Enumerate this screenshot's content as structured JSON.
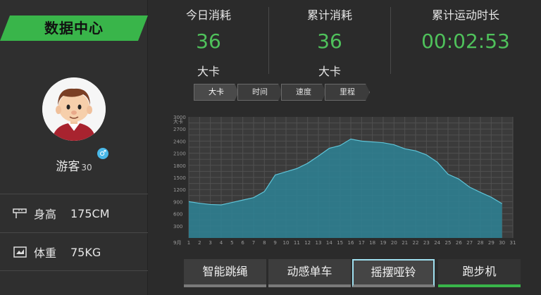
{
  "sidebar": {
    "banner_title": "数据中心",
    "user": {
      "name": "游客",
      "age": "30",
      "gender_symbol": "♂"
    },
    "height": {
      "label": "身高",
      "value": "175CM"
    },
    "weight": {
      "label": "体重",
      "value": "75KG"
    }
  },
  "metrics": [
    {
      "title": "今日消耗",
      "value": "36",
      "unit": "大卡"
    },
    {
      "title": "累计消耗",
      "value": "36",
      "unit": "大卡"
    },
    {
      "title": "累计运动时长",
      "value": "00:02:53"
    }
  ],
  "tabs": [
    {
      "label": "大卡"
    },
    {
      "label": "时间"
    },
    {
      "label": "速度"
    },
    {
      "label": "里程"
    }
  ],
  "chart_data": {
    "type": "area",
    "ylabel": "大卡",
    "xlabel": "9月",
    "ylim": [
      0,
      3000
    ],
    "yticks": [
      300,
      600,
      900,
      1200,
      1500,
      1800,
      2100,
      2400,
      2700,
      3000
    ],
    "x": [
      1,
      2,
      3,
      4,
      5,
      6,
      7,
      8,
      9,
      10,
      11,
      12,
      13,
      14,
      15,
      16,
      17,
      18,
      19,
      20,
      21,
      22,
      23,
      24,
      25,
      26,
      27,
      28,
      29,
      30,
      31
    ],
    "values": [
      900,
      860,
      830,
      820,
      880,
      940,
      1000,
      1150,
      1560,
      1640,
      1720,
      1850,
      2030,
      2220,
      2290,
      2450,
      2400,
      2380,
      2360,
      2310,
      2210,
      2160,
      2060,
      1880,
      1580,
      1460,
      1260,
      1130,
      1010,
      850
    ],
    "colors": {
      "fill": "#2f7f91",
      "line": "#5ec4d8",
      "plot_bg": "#3b3b3b",
      "grid": "#505050"
    },
    "grid": true
  },
  "buttons": [
    {
      "label": "智能跳绳"
    },
    {
      "label": "动感单车"
    },
    {
      "label": "摇摆哑铃"
    },
    {
      "label": "跑步机"
    }
  ],
  "colors": {
    "accent": "#39b54a",
    "value_green": "#4fc15b",
    "selected_border": "#9fe0f0"
  }
}
